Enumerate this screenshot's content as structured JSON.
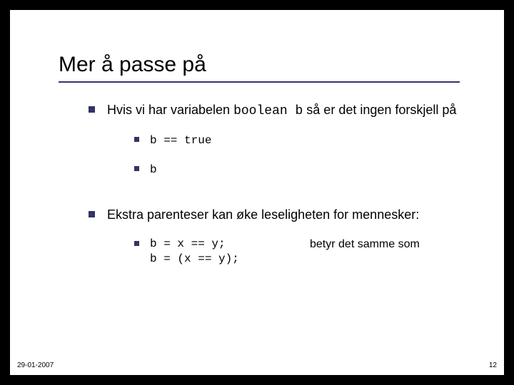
{
  "slide": {
    "title": "Mer å passe på",
    "bullets": [
      {
        "text_before": "Hvis vi har variabelen ",
        "code": "boolean b",
        "text_after": " så er det ingen forskjell på",
        "sub": [
          {
            "code": "b == true"
          },
          {
            "code": "b"
          }
        ]
      },
      {
        "text_before": "Ekstra parenteser kan øke leseligheten for mennesker:",
        "code": "",
        "text_after": "",
        "sub": [
          {
            "code_lines": "b = x == y;\nb = (x == y);",
            "note": "betyr det samme som"
          }
        ]
      }
    ],
    "footer": {
      "date": "29-01-2007",
      "page": "12"
    }
  }
}
